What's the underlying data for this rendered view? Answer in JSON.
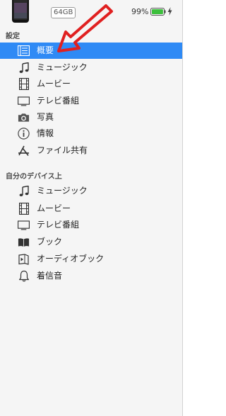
{
  "device": {
    "capacity": "64GB",
    "battery_percent": "99%",
    "battery_level": 0.99,
    "accent_battery": "#3cbf3c"
  },
  "settings": {
    "header": "設定",
    "items": [
      {
        "label": "概要",
        "icon": "summary-icon",
        "selected": true
      },
      {
        "label": "ミュージック",
        "icon": "music-note-icon"
      },
      {
        "label": "ムービー",
        "icon": "film-icon"
      },
      {
        "label": "テレビ番組",
        "icon": "tv-icon"
      },
      {
        "label": "写真",
        "icon": "camera-icon"
      },
      {
        "label": "情報",
        "icon": "info-icon"
      },
      {
        "label": "ファイル共有",
        "icon": "app-store-icon"
      }
    ]
  },
  "on_my_device": {
    "header": "自分のデバイス上",
    "items": [
      {
        "label": "ミュージック",
        "icon": "music-note-icon"
      },
      {
        "label": "ムービー",
        "icon": "film-icon"
      },
      {
        "label": "テレビ番組",
        "icon": "tv-icon"
      },
      {
        "label": "ブック",
        "icon": "book-icon"
      },
      {
        "label": "オーディオブック",
        "icon": "audiobook-icon"
      },
      {
        "label": "着信音",
        "icon": "bell-icon"
      }
    ]
  },
  "colors": {
    "selection": "#2f8af5",
    "annotation_arrow": "#e02020"
  }
}
